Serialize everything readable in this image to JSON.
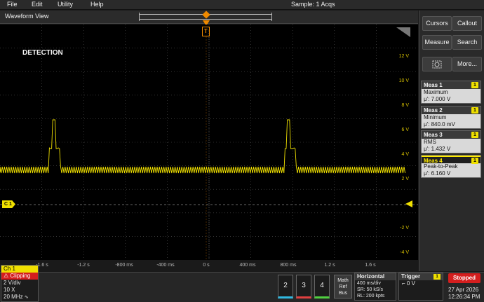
{
  "menu": {
    "items": [
      "File",
      "Edit",
      "Utility",
      "Help"
    ],
    "sample": "Sample: 1 Acqs"
  },
  "waveform_view": {
    "title": "Waveform View",
    "annotation": "DETECTION",
    "y_ticks": [
      "12 V",
      "10 V",
      "8 V",
      "6 V",
      "4 V",
      "2 V",
      "-2 V",
      "-4 V"
    ],
    "x_ticks": [
      "-1.6 s",
      "-1.2 s",
      "-800 ms",
      "-400 ms",
      "0 s",
      "400 ms",
      "800 ms",
      "1.2 s",
      "1.6 s"
    ],
    "channel_marker": "C 1",
    "trigger_marker": "T",
    "trace_color": "#f0e000",
    "trigger_color": "#f08a00"
  },
  "right_panel": {
    "buttons": {
      "cursors": "Cursors",
      "callout": "Callout",
      "measure": "Measure",
      "search": "Search",
      "more": "More..."
    },
    "measurements": [
      {
        "title": "Meas 1",
        "name": "Maximum",
        "value": "μ': 7.000 V",
        "tag": "1"
      },
      {
        "title": "Meas 2",
        "name": "Minimum",
        "value": "μ': 840.0 mV",
        "tag": "1"
      },
      {
        "title": "Meas 3",
        "name": "RMS",
        "value": "μ': 1.432 V",
        "tag": "1"
      },
      {
        "title": "Meas 4",
        "name": "Peak-to-Peak",
        "value": "μ': 6.160 V",
        "tag": "1"
      }
    ]
  },
  "bottom": {
    "ch1": {
      "title": "Ch 1",
      "clipping": "Clipping",
      "vdiv": "2 V/div",
      "probe": "10 X",
      "bw": "20 MHz"
    },
    "channel_buttons": [
      "2",
      "3",
      "4"
    ],
    "math_ref_bus": [
      "Math",
      "Ref",
      "Bus"
    ],
    "horizontal": {
      "title": "Horizontal",
      "scale": "400 ms/div",
      "sr": "SR: 50 kS/s",
      "rl": "RL: 200 kpts"
    },
    "trigger": {
      "title": "Trigger",
      "tag": "1",
      "level": "0 V"
    },
    "status": "Stopped",
    "date": "27 Apr 2026",
    "time": "12:26:34 PM"
  }
}
